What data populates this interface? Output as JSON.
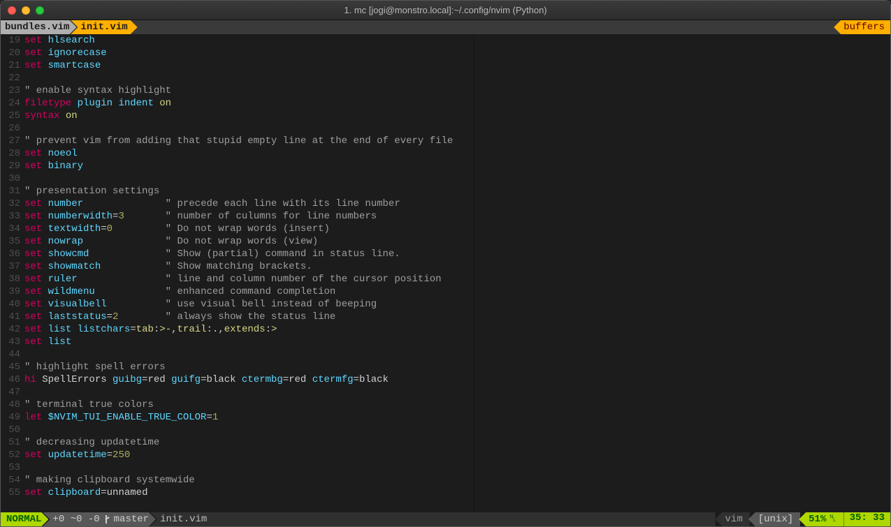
{
  "window": {
    "title": "1. mc [jogi@monstro.local]:~/.config/nvim (Python)"
  },
  "tabs": {
    "inactive": "bundles.vim",
    "active": "init.vim",
    "right": "buffers"
  },
  "code": {
    "first_line": 19,
    "lines": [
      [
        {
          "c": "tok-set",
          "t": "set"
        },
        {
          "c": "tok-white",
          "t": " "
        },
        {
          "c": "tok-opt",
          "t": "hlsearch"
        }
      ],
      [
        {
          "c": "tok-set",
          "t": "set"
        },
        {
          "c": "tok-white",
          "t": " "
        },
        {
          "c": "tok-opt",
          "t": "ignorecase"
        }
      ],
      [
        {
          "c": "tok-set",
          "t": "set"
        },
        {
          "c": "tok-white",
          "t": " "
        },
        {
          "c": "tok-opt",
          "t": "smartcase"
        }
      ],
      [],
      [
        {
          "c": "tok-comment",
          "t": "\" enable syntax highlight"
        }
      ],
      [
        {
          "c": "tok-kw",
          "t": "filetype"
        },
        {
          "c": "tok-white",
          "t": " "
        },
        {
          "c": "tok-blue",
          "t": "plugin"
        },
        {
          "c": "tok-white",
          "t": " "
        },
        {
          "c": "tok-blue",
          "t": "indent"
        },
        {
          "c": "tok-white",
          "t": " "
        },
        {
          "c": "tok-yellow",
          "t": "on"
        }
      ],
      [
        {
          "c": "tok-kw",
          "t": "syntax"
        },
        {
          "c": "tok-white",
          "t": " "
        },
        {
          "c": "tok-yellow",
          "t": "on"
        }
      ],
      [],
      [
        {
          "c": "tok-comment",
          "t": "\" prevent vim from adding that stupid empty line at the end of every file"
        }
      ],
      [
        {
          "c": "tok-set",
          "t": "set"
        },
        {
          "c": "tok-white",
          "t": " "
        },
        {
          "c": "tok-opt",
          "t": "noeol"
        }
      ],
      [
        {
          "c": "tok-set",
          "t": "set"
        },
        {
          "c": "tok-white",
          "t": " "
        },
        {
          "c": "tok-opt",
          "t": "binary"
        }
      ],
      [],
      [
        {
          "c": "tok-comment",
          "t": "\" presentation settings"
        }
      ],
      [
        {
          "c": "tok-set",
          "t": "set"
        },
        {
          "c": "tok-white",
          "t": " "
        },
        {
          "c": "tok-opt",
          "t": "number"
        },
        {
          "c": "tok-white",
          "t": "              "
        },
        {
          "c": "tok-comment",
          "t": "\" precede each line with its line number"
        }
      ],
      [
        {
          "c": "tok-set",
          "t": "set"
        },
        {
          "c": "tok-white",
          "t": " "
        },
        {
          "c": "tok-opt",
          "t": "numberwidth"
        },
        {
          "c": "tok-eq",
          "t": "="
        },
        {
          "c": "tok-num",
          "t": "3"
        },
        {
          "c": "tok-white",
          "t": "       "
        },
        {
          "c": "tok-comment",
          "t": "\" number of culumns for line numbers"
        }
      ],
      [
        {
          "c": "tok-set",
          "t": "set"
        },
        {
          "c": "tok-white",
          "t": " "
        },
        {
          "c": "tok-opt",
          "t": "textwidth"
        },
        {
          "c": "tok-eq",
          "t": "="
        },
        {
          "c": "tok-num",
          "t": "0"
        },
        {
          "c": "tok-white",
          "t": "         "
        },
        {
          "c": "tok-comment",
          "t": "\" Do not wrap words (insert)"
        }
      ],
      [
        {
          "c": "tok-set",
          "t": "set"
        },
        {
          "c": "tok-white",
          "t": " "
        },
        {
          "c": "tok-opt",
          "t": "nowrap"
        },
        {
          "c": "tok-white",
          "t": "              "
        },
        {
          "c": "tok-comment",
          "t": "\" Do not wrap words (view)"
        }
      ],
      [
        {
          "c": "tok-set",
          "t": "set"
        },
        {
          "c": "tok-white",
          "t": " "
        },
        {
          "c": "tok-opt",
          "t": "showcmd"
        },
        {
          "c": "tok-white",
          "t": "             "
        },
        {
          "c": "tok-comment",
          "t": "\" Show (partial) command in status line."
        }
      ],
      [
        {
          "c": "tok-set",
          "t": "set"
        },
        {
          "c": "tok-white",
          "t": " "
        },
        {
          "c": "tok-opt",
          "t": "showmatch"
        },
        {
          "c": "tok-white",
          "t": "           "
        },
        {
          "c": "tok-comment",
          "t": "\" Show matching brackets."
        }
      ],
      [
        {
          "c": "tok-set",
          "t": "set"
        },
        {
          "c": "tok-white",
          "t": " "
        },
        {
          "c": "tok-opt",
          "t": "ruler"
        },
        {
          "c": "tok-white",
          "t": "               "
        },
        {
          "c": "tok-comment",
          "t": "\" line and column number of the cursor position"
        }
      ],
      [
        {
          "c": "tok-set",
          "t": "set"
        },
        {
          "c": "tok-white",
          "t": " "
        },
        {
          "c": "tok-opt",
          "t": "wildmenu"
        },
        {
          "c": "tok-white",
          "t": "            "
        },
        {
          "c": "tok-comment",
          "t": "\" enhanced command completion"
        }
      ],
      [
        {
          "c": "tok-set",
          "t": "set"
        },
        {
          "c": "tok-white",
          "t": " "
        },
        {
          "c": "tok-opt",
          "t": "visualbell"
        },
        {
          "c": "tok-white",
          "t": "          "
        },
        {
          "c": "tok-comment",
          "t": "\" use visual bell instead of beeping"
        }
      ],
      [
        {
          "c": "tok-set",
          "t": "set"
        },
        {
          "c": "tok-white",
          "t": " "
        },
        {
          "c": "tok-opt",
          "t": "laststatus"
        },
        {
          "c": "tok-eq",
          "t": "="
        },
        {
          "c": "tok-num",
          "t": "2"
        },
        {
          "c": "tok-white",
          "t": "        "
        },
        {
          "c": "tok-comment",
          "t": "\" always show the status line"
        }
      ],
      [
        {
          "c": "tok-set",
          "t": "set"
        },
        {
          "c": "tok-white",
          "t": " "
        },
        {
          "c": "tok-opt",
          "t": "list"
        },
        {
          "c": "tok-white",
          "t": " "
        },
        {
          "c": "tok-opt",
          "t": "listchars"
        },
        {
          "c": "tok-eq",
          "t": "="
        },
        {
          "c": "tok-yellow",
          "t": "tab"
        },
        {
          "c": "tok-eq",
          "t": ":"
        },
        {
          "c": "tok-yellow",
          "t": ">-"
        },
        {
          "c": "tok-eq",
          "t": ","
        },
        {
          "c": "tok-yellow",
          "t": "trail"
        },
        {
          "c": "tok-eq",
          "t": ":"
        },
        {
          "c": "tok-yellow",
          "t": "."
        },
        {
          "c": "tok-eq",
          "t": ","
        },
        {
          "c": "tok-yellow",
          "t": "extends"
        },
        {
          "c": "tok-eq",
          "t": ":"
        },
        {
          "c": "tok-yellow",
          "t": ">"
        }
      ],
      [
        {
          "c": "tok-set",
          "t": "set"
        },
        {
          "c": "tok-white",
          "t": " "
        },
        {
          "c": "tok-opt",
          "t": "list"
        }
      ],
      [],
      [
        {
          "c": "tok-comment",
          "t": "\" highlight spell errors"
        }
      ],
      [
        {
          "c": "tok-set",
          "t": "hi"
        },
        {
          "c": "tok-white",
          "t": " SpellErrors "
        },
        {
          "c": "tok-opt",
          "t": "guibg"
        },
        {
          "c": "tok-eq",
          "t": "="
        },
        {
          "c": "tok-white",
          "t": "red "
        },
        {
          "c": "tok-opt",
          "t": "guifg"
        },
        {
          "c": "tok-eq",
          "t": "="
        },
        {
          "c": "tok-white",
          "t": "black "
        },
        {
          "c": "tok-opt",
          "t": "ctermbg"
        },
        {
          "c": "tok-eq",
          "t": "="
        },
        {
          "c": "tok-white",
          "t": "red "
        },
        {
          "c": "tok-opt",
          "t": "ctermfg"
        },
        {
          "c": "tok-eq",
          "t": "="
        },
        {
          "c": "tok-white",
          "t": "black"
        }
      ],
      [],
      [
        {
          "c": "tok-comment",
          "t": "\" terminal true colors"
        }
      ],
      [
        {
          "c": "tok-set",
          "t": "let"
        },
        {
          "c": "tok-white",
          "t": " "
        },
        {
          "c": "tok-opt",
          "t": "$NVIM_TUI_ENABLE_TRUE_COLOR"
        },
        {
          "c": "tok-eq",
          "t": "="
        },
        {
          "c": "tok-num",
          "t": "1"
        }
      ],
      [],
      [
        {
          "c": "tok-comment",
          "t": "\" decreasing updatetime"
        }
      ],
      [
        {
          "c": "tok-set",
          "t": "set"
        },
        {
          "c": "tok-white",
          "t": " "
        },
        {
          "c": "tok-opt",
          "t": "updatetime"
        },
        {
          "c": "tok-eq",
          "t": "="
        },
        {
          "c": "tok-num",
          "t": "250"
        }
      ],
      [],
      [
        {
          "c": "tok-comment",
          "t": "\" making clipboard systemwide"
        }
      ],
      [
        {
          "c": "tok-set",
          "t": "set"
        },
        {
          "c": "tok-white",
          "t": " "
        },
        {
          "c": "tok-opt",
          "t": "clipboard"
        },
        {
          "c": "tok-eq",
          "t": "="
        },
        {
          "c": "tok-white",
          "t": "unnamed"
        }
      ]
    ]
  },
  "status": {
    "mode": "NORMAL",
    "git_stats": "+0 ~0 -0",
    "branch": "master",
    "file": "init.vim",
    "filetype": "vim",
    "encoding": "[unix]",
    "percent": "51%",
    "pos": " 35: 33"
  },
  "colors": {
    "accent_green": "#afd700",
    "accent_orange": "#ffaf00",
    "magenta": "#d7005f",
    "cyan": "#5fd7ff"
  }
}
